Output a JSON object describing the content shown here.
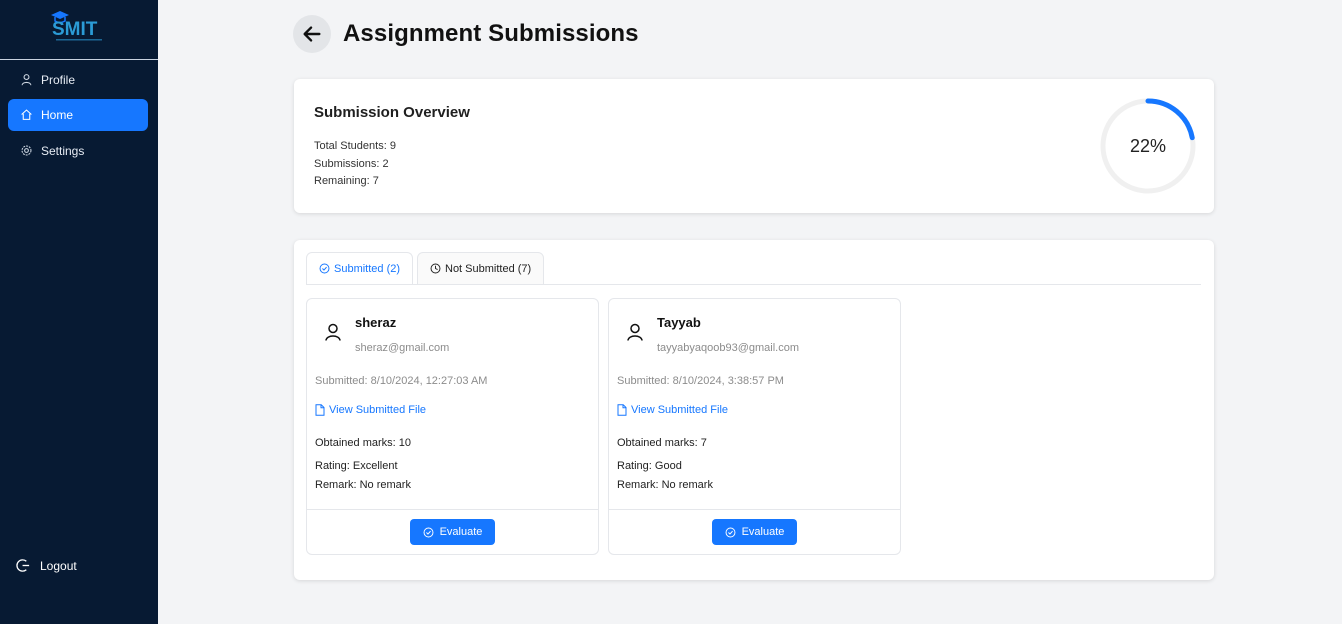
{
  "sidebar": {
    "logo_text": "SMIT",
    "items": [
      {
        "label": "Profile",
        "icon": "user-icon"
      },
      {
        "label": "Home",
        "icon": "home-icon",
        "active": true
      },
      {
        "label": "Settings",
        "icon": "gear-icon"
      }
    ],
    "logout_label": "Logout"
  },
  "header": {
    "title": "Assignment Submissions",
    "back_icon": "arrow-left-icon"
  },
  "overview": {
    "title": "Submission Overview",
    "total_students": "Total Students: 9",
    "submissions": "Submissions: 2",
    "remaining": "Remaining: 7",
    "progress_percent": 22,
    "progress_label": "22%"
  },
  "tabs": [
    {
      "label": "Submitted (2)",
      "icon": "check-circle-icon",
      "active": true
    },
    {
      "label": "Not Submitted (7)",
      "icon": "clock-icon",
      "active": false
    }
  ],
  "submissions": [
    {
      "name": "sheraz",
      "email": "sheraz@gmail.com",
      "submitted": "Submitted: 8/10/2024, 12:27:03 AM",
      "file_link": "View Submitted File",
      "marks": "Obtained marks: 10",
      "rating": "Rating: Excellent",
      "remark": "Remark: No remark",
      "button": "Evaluate"
    },
    {
      "name": "Tayyab",
      "email": "tayyabyaqoob93@gmail.com",
      "submitted": "Submitted: 8/10/2024, 3:38:57 PM",
      "file_link": "View Submitted File",
      "marks": "Obtained marks: 7",
      "rating": "Rating: Good",
      "remark": "Remark: No remark",
      "button": "Evaluate"
    }
  ],
  "colors": {
    "sidebar_bg": "#071a33",
    "accent": "#1677ff",
    "page_bg": "#f3f4f6"
  }
}
